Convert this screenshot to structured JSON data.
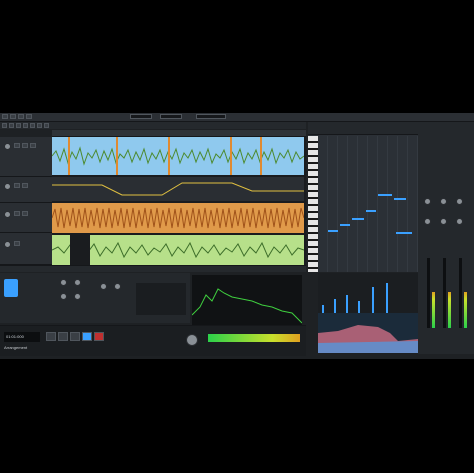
{
  "transport": {
    "time": "01:01:000",
    "mode_label": "Arrangement"
  },
  "colors": {
    "accent": "#3aa0ff",
    "audio_blue": "#8fc9ee",
    "audio_orange": "#e09a4a",
    "audio_green": "#b7e08a",
    "spectrum_green": "#3fcf3f"
  },
  "track_names": [
    "Audio 01",
    "Audio 02",
    "Audio 03",
    "Audio 04"
  ],
  "icons": {
    "play": "play-icon",
    "stop": "stop-icon",
    "record": "record-icon",
    "loop": "loop-icon"
  }
}
